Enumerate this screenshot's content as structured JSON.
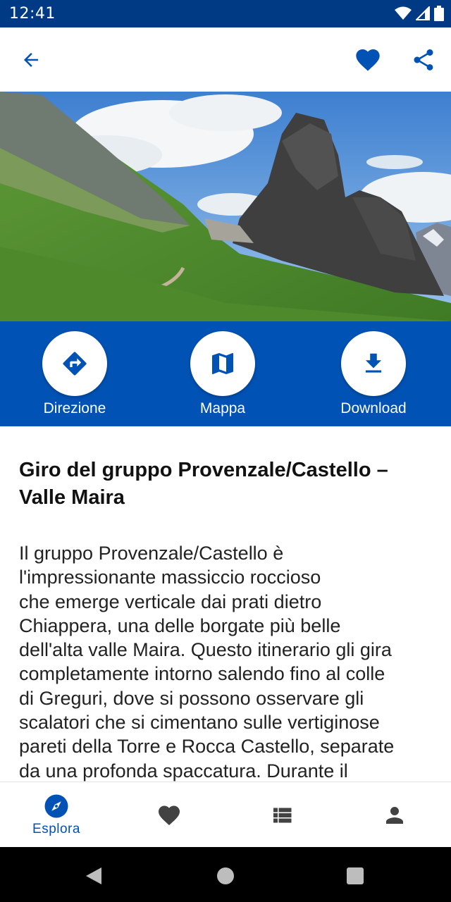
{
  "status_bar": {
    "time": "12:41"
  },
  "toolbar": {
    "back_icon": "arrow-back-icon",
    "favorite_icon": "heart-icon",
    "share_icon": "share-icon"
  },
  "actions": [
    {
      "label": "Direzione",
      "icon": "directions-icon"
    },
    {
      "label": "Mappa",
      "icon": "map-icon"
    },
    {
      "label": "Download",
      "icon": "download-icon"
    }
  ],
  "route": {
    "title_line1": "Giro del gruppo Provenzale/Castello –",
    "title_line2": "Valle Maira",
    "description": [
      "Il gruppo Provenzale/Castello è",
      "l'impressionante massiccio roccioso",
      "che emerge verticale dai prati dietro",
      "Chiappera, una delle borgate più belle",
      "dell'alta valle Maira. Questo itinerario gli gira",
      "completamente intorno salendo fino al colle",
      "di Greguri, dove si possono osservare gli",
      "scalatori che si cimentano sulle vertiginose",
      "pareti della Torre e Rocca Castello, separate",
      "da una profonda spaccatura. Durante il"
    ]
  },
  "bottom_nav": [
    {
      "label": "Esplora",
      "icon": "compass-icon",
      "active": true
    },
    {
      "label": "",
      "icon": "heart-icon",
      "active": false
    },
    {
      "label": "",
      "icon": "list-icon",
      "active": false
    },
    {
      "label": "",
      "icon": "person-icon",
      "active": false
    }
  ],
  "colors": {
    "primary": "#0052b4",
    "status_bar": "#003a85",
    "icon_inactive": "#424242"
  }
}
